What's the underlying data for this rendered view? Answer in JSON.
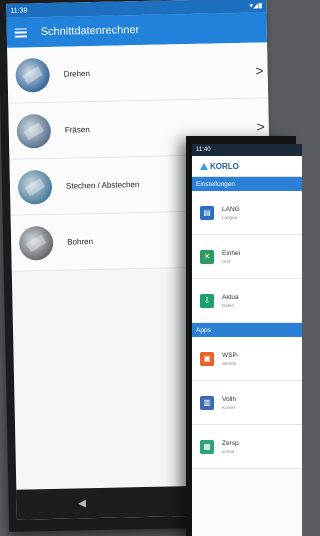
{
  "back_phone": {
    "status_time": "11:39",
    "status_right": "▾◢▮",
    "app_title": "Schnittdatenrechner",
    "items": [
      {
        "label": "Drehen",
        "color": "#3a6aa0"
      },
      {
        "label": "Fräsen",
        "color": "#5d7490"
      },
      {
        "label": "Stechen / Abstechen",
        "color": "#4b7f9c"
      },
      {
        "label": "Bohren",
        "color": "#6a6a6a"
      }
    ],
    "chevron": ">",
    "nav": [
      "◀",
      "●"
    ]
  },
  "front_phone": {
    "status_time": "11:40",
    "brand": "KORLO",
    "sections": [
      {
        "title": "Einstellungen",
        "items": [
          {
            "title": "LANG",
            "sub": "Langua",
            "color": "#2b6cc4",
            "glyph": "▤"
          },
          {
            "title": "Einhei",
            "sub": "Unit",
            "color": "#2c9b5e",
            "glyph": "✕"
          },
          {
            "title": "Aktua",
            "sub": "Daten",
            "color": "#1f9e6e",
            "glyph": "⇩"
          }
        ]
      },
      {
        "title": "Apps",
        "items": [
          {
            "title": "WSP-",
            "sub": "Wende",
            "color": "#e8632b",
            "glyph": "▣"
          },
          {
            "title": "Vollh",
            "sub": "Konve",
            "color": "#3b6cb0",
            "glyph": "▥"
          },
          {
            "title": "Zersp",
            "sub": "echna",
            "color": "#2aa27a",
            "glyph": "▦"
          }
        ]
      }
    ]
  }
}
